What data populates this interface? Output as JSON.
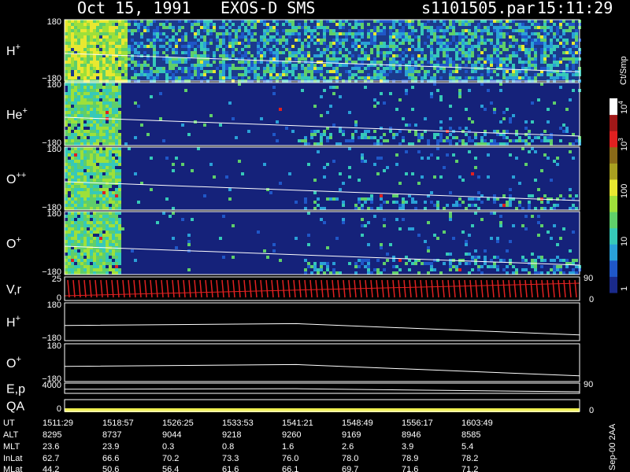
{
  "header": {
    "date": "Oct 15, 1991",
    "instrument": "EXOS-D SMS",
    "file": "s1101505.par",
    "time": "15:11:29"
  },
  "colorbar": {
    "unit": "Ct/Smp",
    "tick_labels": [
      "1",
      "10",
      "100",
      "10",
      "10"
    ],
    "tick_exponents": [
      "",
      "",
      "",
      "3",
      "4"
    ],
    "levels": [
      1,
      10,
      100,
      1000,
      10000
    ],
    "colors": [
      "#1a2a8a",
      "#1f57c8",
      "#2aa0d8",
      "#36c9b8",
      "#5fcf6a",
      "#9ee03a",
      "#e8e830",
      "#a8a020",
      "#8a6a18",
      "#e02020",
      "#a01818",
      "#ffffff"
    ]
  },
  "panels": [
    {
      "id": "h-plus",
      "species": "H",
      "charge": "+",
      "ymax": "180",
      "ymin": "−180",
      "kind": "spectrogram"
    },
    {
      "id": "he-plus",
      "species": "He",
      "charge": "+",
      "ymax": "180",
      "ymin": "−180",
      "kind": "spectrogram"
    },
    {
      "id": "o-plusplus",
      "species": "O",
      "charge": "++",
      "ymax": "180",
      "ymin": "−180",
      "kind": "spectrogram"
    },
    {
      "id": "o-plus",
      "species": "O",
      "charge": "+",
      "ymax": "180",
      "ymin": "−180",
      "kind": "spectrogram"
    },
    {
      "id": "vr",
      "species": "V,r",
      "charge": "",
      "ymax": "25",
      "ymin": "0",
      "right_top": "90",
      "right_bottom": "0",
      "kind": "velocity"
    },
    {
      "id": "h-plus-2",
      "species": "H",
      "charge": "+",
      "ymax": "180",
      "ymin": "−180",
      "kind": "line"
    },
    {
      "id": "o-plus-2",
      "species": "O",
      "charge": "+",
      "ymax": "180",
      "ymin": "−180",
      "kind": "line"
    },
    {
      "id": "ep",
      "species": "E,p",
      "charge": "",
      "ymax": "4000",
      "ymin": "",
      "right_top": "90",
      "kind": "line"
    },
    {
      "id": "qa",
      "species": "QA",
      "charge": "",
      "ymax": "",
      "ymin": "0",
      "right_bottom": "0",
      "kind": "qa"
    }
  ],
  "ephemeris": {
    "row_labels": [
      "UT",
      "ALT",
      "MLT",
      "InLat",
      "MLat"
    ],
    "columns": [
      {
        "UT": "1511:29",
        "ALT": "8295",
        "MLT": "23.6",
        "InLat": "62.7",
        "MLat": "44.2"
      },
      {
        "UT": "1518:57",
        "ALT": "8737",
        "MLT": "23.9",
        "InLat": "66.6",
        "MLat": "50.6"
      },
      {
        "UT": "1526:25",
        "ALT": "9044",
        "MLT": "0.3",
        "InLat": "70.2",
        "MLat": "56.4"
      },
      {
        "UT": "1533:53",
        "ALT": "9218",
        "MLT": "0.8",
        "InLat": "73.3",
        "MLat": "61.6"
      },
      {
        "UT": "1541:21",
        "ALT": "9260",
        "MLT": "1.6",
        "InLat": "76.0",
        "MLat": "66.1"
      },
      {
        "UT": "1548:49",
        "ALT": "9169",
        "MLT": "2.6",
        "InLat": "78.0",
        "MLat": "69.7"
      },
      {
        "UT": "1556:17",
        "ALT": "8946",
        "MLT": "3.9",
        "InLat": "78.9",
        "MLat": "71.6"
      },
      {
        "UT": "1603:49",
        "ALT": "8585",
        "MLT": "5.4",
        "InLat": "78.2",
        "MLat": "71.2"
      }
    ]
  },
  "footer_note": "Sep-00 2AA",
  "chart_data": {
    "type": "heatmap",
    "title": "Oct 15, 1991   EXOS-D SMS",
    "x": [
      "1511:29",
      "1518:57",
      "1526:25",
      "1533:53",
      "1541:21",
      "1548:49",
      "1556:17",
      "1603:49"
    ],
    "xlabel": "UT",
    "series": [
      {
        "name": "H+",
        "ylim": [
          -180,
          180
        ]
      },
      {
        "name": "He+",
        "ylim": [
          -180,
          180
        ]
      },
      {
        "name": "O++",
        "ylim": [
          -180,
          180
        ]
      },
      {
        "name": "O+",
        "ylim": [
          -180,
          180
        ]
      },
      {
        "name": "V,r",
        "ylim": [
          0,
          25
        ]
      },
      {
        "name": "H+",
        "ylim": [
          -180,
          180
        ]
      },
      {
        "name": "O+",
        "ylim": [
          -180,
          180
        ]
      },
      {
        "name": "E,p",
        "ylim": [
          0,
          4000
        ]
      },
      {
        "name": "QA",
        "ylim": [
          0,
          null
        ]
      }
    ],
    "colorscale": {
      "unit": "Ct/Smp",
      "scale": "log",
      "range": [
        1,
        10000
      ]
    }
  }
}
